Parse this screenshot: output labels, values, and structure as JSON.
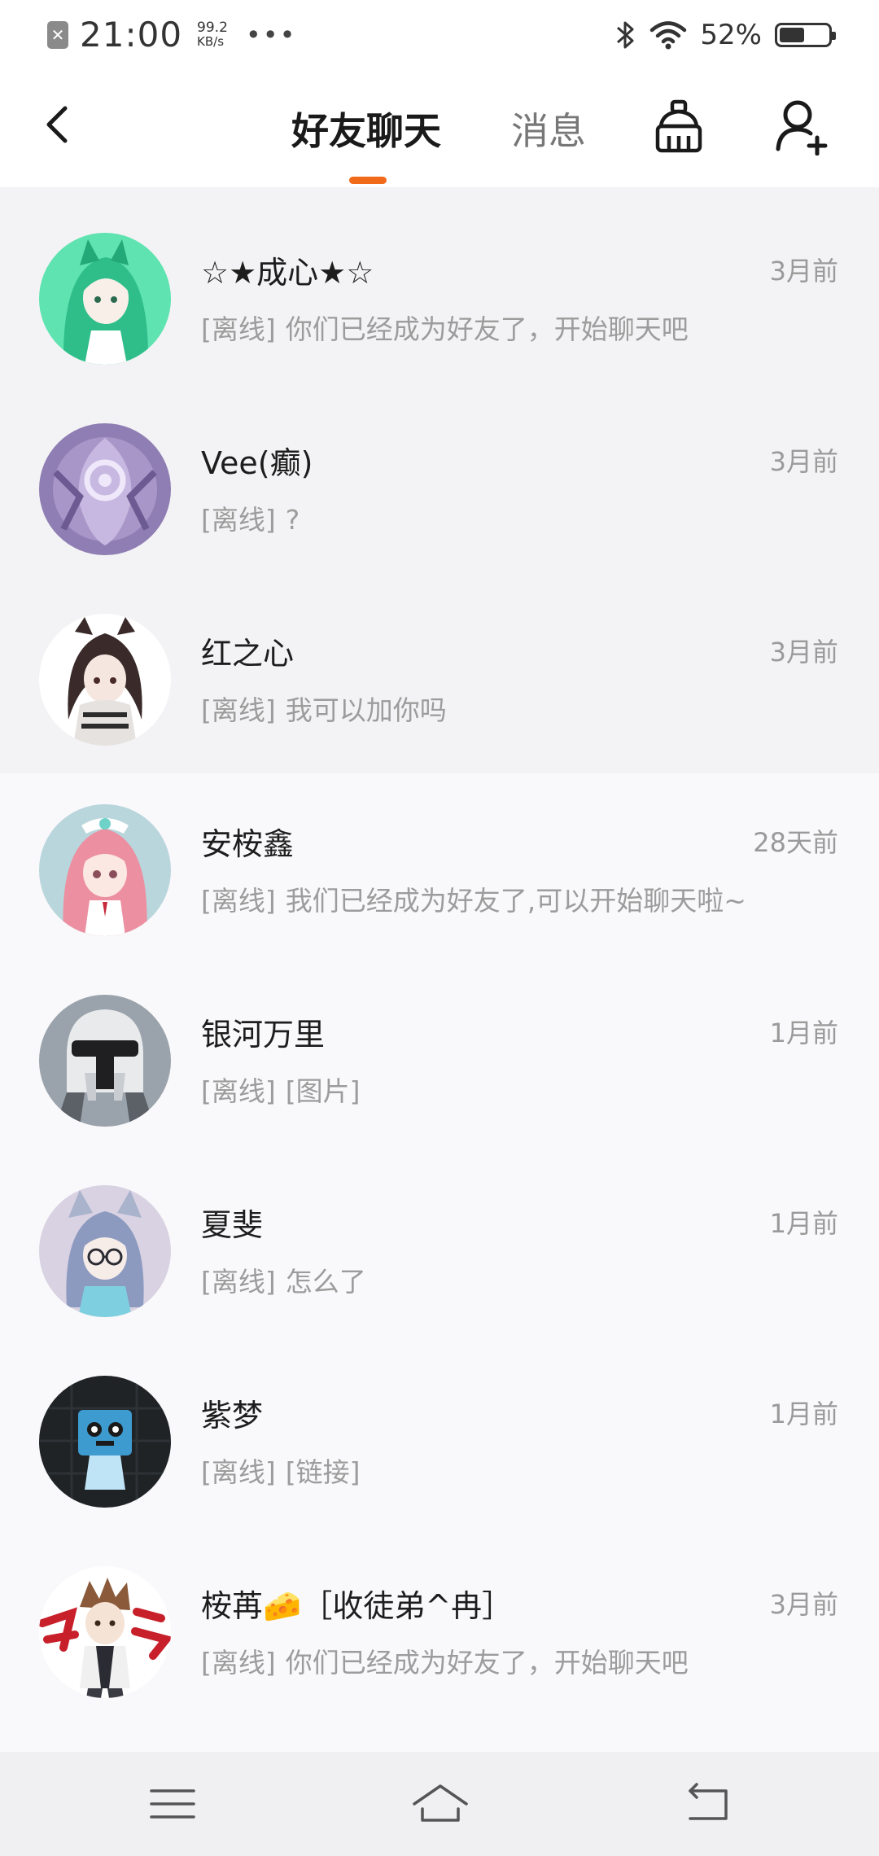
{
  "status_bar": {
    "time": "21:00",
    "speed_value": "99.2",
    "speed_unit": "KB/s",
    "more": "•••",
    "battery_percent": "52%",
    "battery_level": 0.52
  },
  "header": {
    "tabs": [
      {
        "label": "好友聊天",
        "active": true
      },
      {
        "label": "消息",
        "active": false
      }
    ],
    "accent_color": "#f06a1a"
  },
  "chats": [
    {
      "name": "☆★成心★☆",
      "time": "3月前",
      "status": "[离线]",
      "message": "你们已经成为好友了，开始聊天吧",
      "avatar_icon": "green-haired-anime-girl-avatar"
    },
    {
      "name": "Vee(癫)",
      "time": "3月前",
      "status": "[离线]",
      "message": "?",
      "avatar_icon": "purple-emblem-avatar"
    },
    {
      "name": "红之心",
      "time": "3月前",
      "status": "[离线]",
      "message": "我可以加你吗",
      "avatar_icon": "anime-girl-avatar"
    },
    {
      "name": "安桉鑫",
      "time": "28天前",
      "status": "[离线]",
      "message": "我们已经成为好友了,可以开始聊天啦~",
      "avatar_icon": "pink-haired-anime-girl-avatar"
    },
    {
      "name": "银河万里",
      "time": "1月前",
      "status": "[离线]",
      "message": "[图片]",
      "avatar_icon": "helmet-avatar"
    },
    {
      "name": "夏斐",
      "time": "1月前",
      "status": "[离线]",
      "message": "怎么了",
      "avatar_icon": "cat-eared-girl-with-glasses-avatar"
    },
    {
      "name": "紫梦",
      "time": "1月前",
      "status": "[离线]",
      "message": "[链接]",
      "avatar_icon": "blue-box-robot-avatar"
    },
    {
      "name": "桉苒🧀［收徒弟^冉］",
      "time": "3月前",
      "status": "[离线]",
      "message": "你们已经成为好友了，开始聊天吧",
      "avatar_icon": "anime-boy-calligraphy-avatar"
    }
  ]
}
